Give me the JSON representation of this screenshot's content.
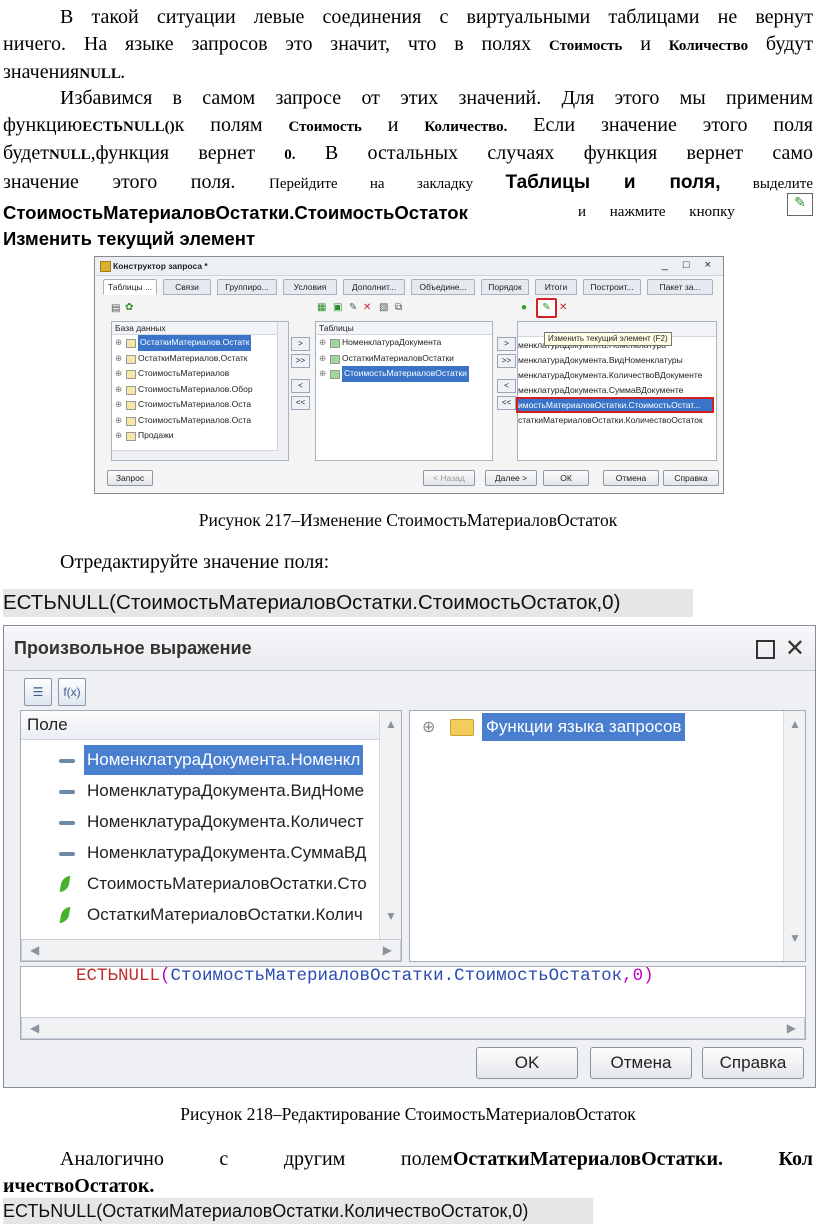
{
  "para1": {
    "l1": "В такой ситуации левые соединения с виртуальными таблицами не вернут",
    "l2a": "ничего. На языке запросов это значит, что в полях ",
    "l2b": "Стоимость",
    "l2c": " и ",
    "l2d": "Количество",
    "l2e": " будут",
    "l3a": "значения",
    "l3b": "NULL."
  },
  "para2": {
    "l1": "Избавимся в самом запросе от этих значений. Для этого мы применим",
    "l2a": "функцию",
    "l2b": "ЕСТЬNULL()",
    "l2c": "к полям ",
    "l2d": "Стоимость",
    "l2e": " и ",
    "l2f": "Количество.",
    "l2g": " Если значение этого поля",
    "l3a": "будет",
    "l3b": "NULL",
    "l3c": ",функция вернет ",
    "l3d": "0.",
    "l3e": " В остальных случаях функция вернет само",
    "l4a": "значение этого поля. ",
    "l4b": "Перейдите на закладку ",
    "l4c": "Таблицы и поля,",
    "l4d": " выделите",
    "l5a": "СтоимостьМатериаловОстатки.СтоимостьОстаток",
    "l5b": "и нажмите кнопку",
    "l6": "Изменить текущий элемент"
  },
  "window1": {
    "title": "Конструктор запроса *",
    "controls": "_ □ ×",
    "tabs": [
      "Таблицы ...",
      "Связи",
      "Группиро...",
      "Условия",
      "Дополнит...",
      "Объедине...",
      "Порядок",
      "Итоги",
      "Построит...",
      "Пакет за..."
    ],
    "db_header": "База данных",
    "db_items": [
      "ОстаткиМатериалов.Остатк",
      "ОстаткиМатериалов.Остатк",
      "СтоимостьМатериалов",
      "СтоимостьМатериалов.Обор",
      "СтоимостьМатериалов.Оста",
      "СтоимостьМатериалов.Оста",
      "Продажи"
    ],
    "tables_header": "Таблицы",
    "tables_items": [
      "НоменклатураДокумента",
      "ОстаткиМатериаловОстатки",
      "СтоимостьМатериаловОстатки"
    ],
    "tooltip": "Изменить текущий элемент (F2)",
    "fields_items": [
      "менклатураДокумента.Номенклатура",
      "менклатураДокумента.ВидНоменклатуры",
      "менклатураДокумента.КоличествоВДокументе",
      "менклатураДокумента.СуммаВДокументе",
      "имостьМатериаловОстатки.СтоимостьОстат...",
      "статкиМатериаловОстатки.КоличествоОстаток"
    ],
    "move_buttons": [
      ">",
      ">>",
      "<",
      "<<"
    ],
    "buttons": {
      "query": "Запрос",
      "back": "< Назад",
      "next": "Далее >",
      "ok": "ОК",
      "cancel": "Отмена",
      "help": "Справка"
    }
  },
  "caption1": "Рисунок 217–Изменение СтоимостьМатериаловОстаток",
  "para3": "Отредактируйте значение поля:",
  "banner1": "ЕСТЬNULL(СтоимостьМатериаловОстатки.СтоимостьОстаток,0)",
  "window2": {
    "title": "Произвольное выражение",
    "field_header": "Поле",
    "fields": [
      {
        "label": "НоменклатураДокумента.Номенкл",
        "icon": "field-dash-icon",
        "selected": true
      },
      {
        "label": "НоменклатураДокумента.ВидНоме",
        "icon": "field-dash-icon",
        "selected": false
      },
      {
        "label": "НоменклатураДокумента.Количест",
        "icon": "field-dash-icon",
        "selected": false
      },
      {
        "label": "НоменклатураДокумента.СуммаВД",
        "icon": "field-dash-icon",
        "selected": false
      },
      {
        "label": "СтоимостьМатериаловОстатки.Сто",
        "icon": "resource-leaf-icon",
        "selected": false
      },
      {
        "label": "ОстаткиМатериаловОстатки.Колич",
        "icon": "resource-leaf-icon",
        "selected": false
      }
    ],
    "functions_label": "Функции языка запросов",
    "expression": {
      "fn": "ЕСТЬNULL",
      "open": "(",
      "arg": "СтоимостьМатериаловОстатки.СтоимостьОстаток",
      "comma": ",",
      "zero": "0",
      "close": ")"
    },
    "buttons": {
      "ok": "OK",
      "cancel": "Отмена",
      "help": "Справка"
    }
  },
  "caption2": "Рисунок 218–Редактирование СтоимостьМатериаловОстаток",
  "para4": {
    "l1a": "Аналогично с другим полем",
    "l1b": "ОстаткиМатериаловОстатки. Кол",
    "l2": "ичествоОстаток."
  },
  "banner2": "ЕСТЬNULL(ОстаткиМатериаловОстатки.КоличествоОстаток,0)"
}
